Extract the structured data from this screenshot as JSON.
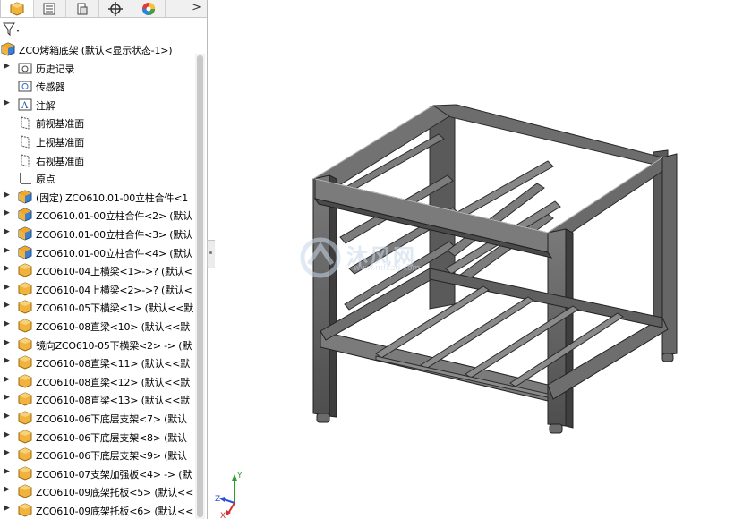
{
  "filter": {
    "icon": "filter-icon"
  },
  "tree": {
    "root": "ZCO烤箱底架  (默认<显示状态-1>)",
    "folders": [
      {
        "label": "历史记录"
      },
      {
        "label": "传感器"
      },
      {
        "label": "注解"
      },
      {
        "label": "前视基准面"
      },
      {
        "label": "上视基准面"
      },
      {
        "label": "右视基准面"
      },
      {
        "label": "原点"
      }
    ],
    "components": [
      {
        "label": "(固定) ZCO610.01-00立柱合件<1",
        "kind": "assembly"
      },
      {
        "label": "ZCO610.01-00立柱合件<2> (默认",
        "kind": "assembly"
      },
      {
        "label": "ZCO610.01-00立柱合件<3> (默认",
        "kind": "assembly"
      },
      {
        "label": "ZCO610.01-00立柱合件<4> (默认",
        "kind": "assembly"
      },
      {
        "label": "ZCO610-04上横梁<1>->? (默认<",
        "kind": "part"
      },
      {
        "label": "ZCO610-04上横梁<2>->? (默认<",
        "kind": "part"
      },
      {
        "label": "ZCO610-05下横梁<1> (默认<<默",
        "kind": "part"
      },
      {
        "label": "ZCO610-08直梁<10> (默认<<默",
        "kind": "part"
      },
      {
        "label": "镜向ZCO610-05下横梁<2> -> (默",
        "kind": "part"
      },
      {
        "label": "ZCO610-08直梁<11> (默认<<默",
        "kind": "part"
      },
      {
        "label": "ZCO610-08直梁<12> (默认<<默",
        "kind": "part"
      },
      {
        "label": "ZCO610-08直梁<13> (默认<<默",
        "kind": "part"
      },
      {
        "label": "ZCO610-06下底层支架<7> (默认",
        "kind": "part"
      },
      {
        "label": "ZCO610-06下底层支架<8> (默认",
        "kind": "part"
      },
      {
        "label": "ZCO610-06下底层支架<9> (默认",
        "kind": "part"
      },
      {
        "label": "ZCO610-07支架加强板<4> -> (默",
        "kind": "part"
      },
      {
        "label": "ZCO610-09底架托板<5> (默认<<",
        "kind": "part"
      },
      {
        "label": "ZCO610-09底架托板<6> (默认<<",
        "kind": "part"
      }
    ]
  },
  "watermark": {
    "title": "沐风网",
    "subtitle": "www.mfcad.com"
  },
  "triad": {
    "x": "X",
    "y": "Y",
    "z": "Z"
  },
  "colors": {
    "accent": "#f5a623",
    "assembly": "#3b7fd0",
    "steel": "#5e5e5e",
    "panel_bg": "#ffffff"
  }
}
